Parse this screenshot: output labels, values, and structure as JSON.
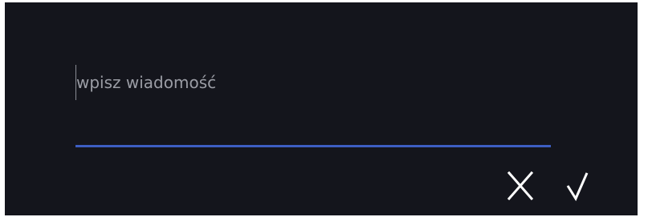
{
  "dialog": {
    "input": {
      "value": "",
      "placeholder": "wpisz wiadomość"
    },
    "actions": {
      "cancel_icon": "close-icon",
      "confirm_icon": "check-icon"
    },
    "colors": {
      "background": "#14151c",
      "underline": "#3d5ec2",
      "placeholder": "#9b9da5",
      "icon": "#ffffff"
    }
  }
}
